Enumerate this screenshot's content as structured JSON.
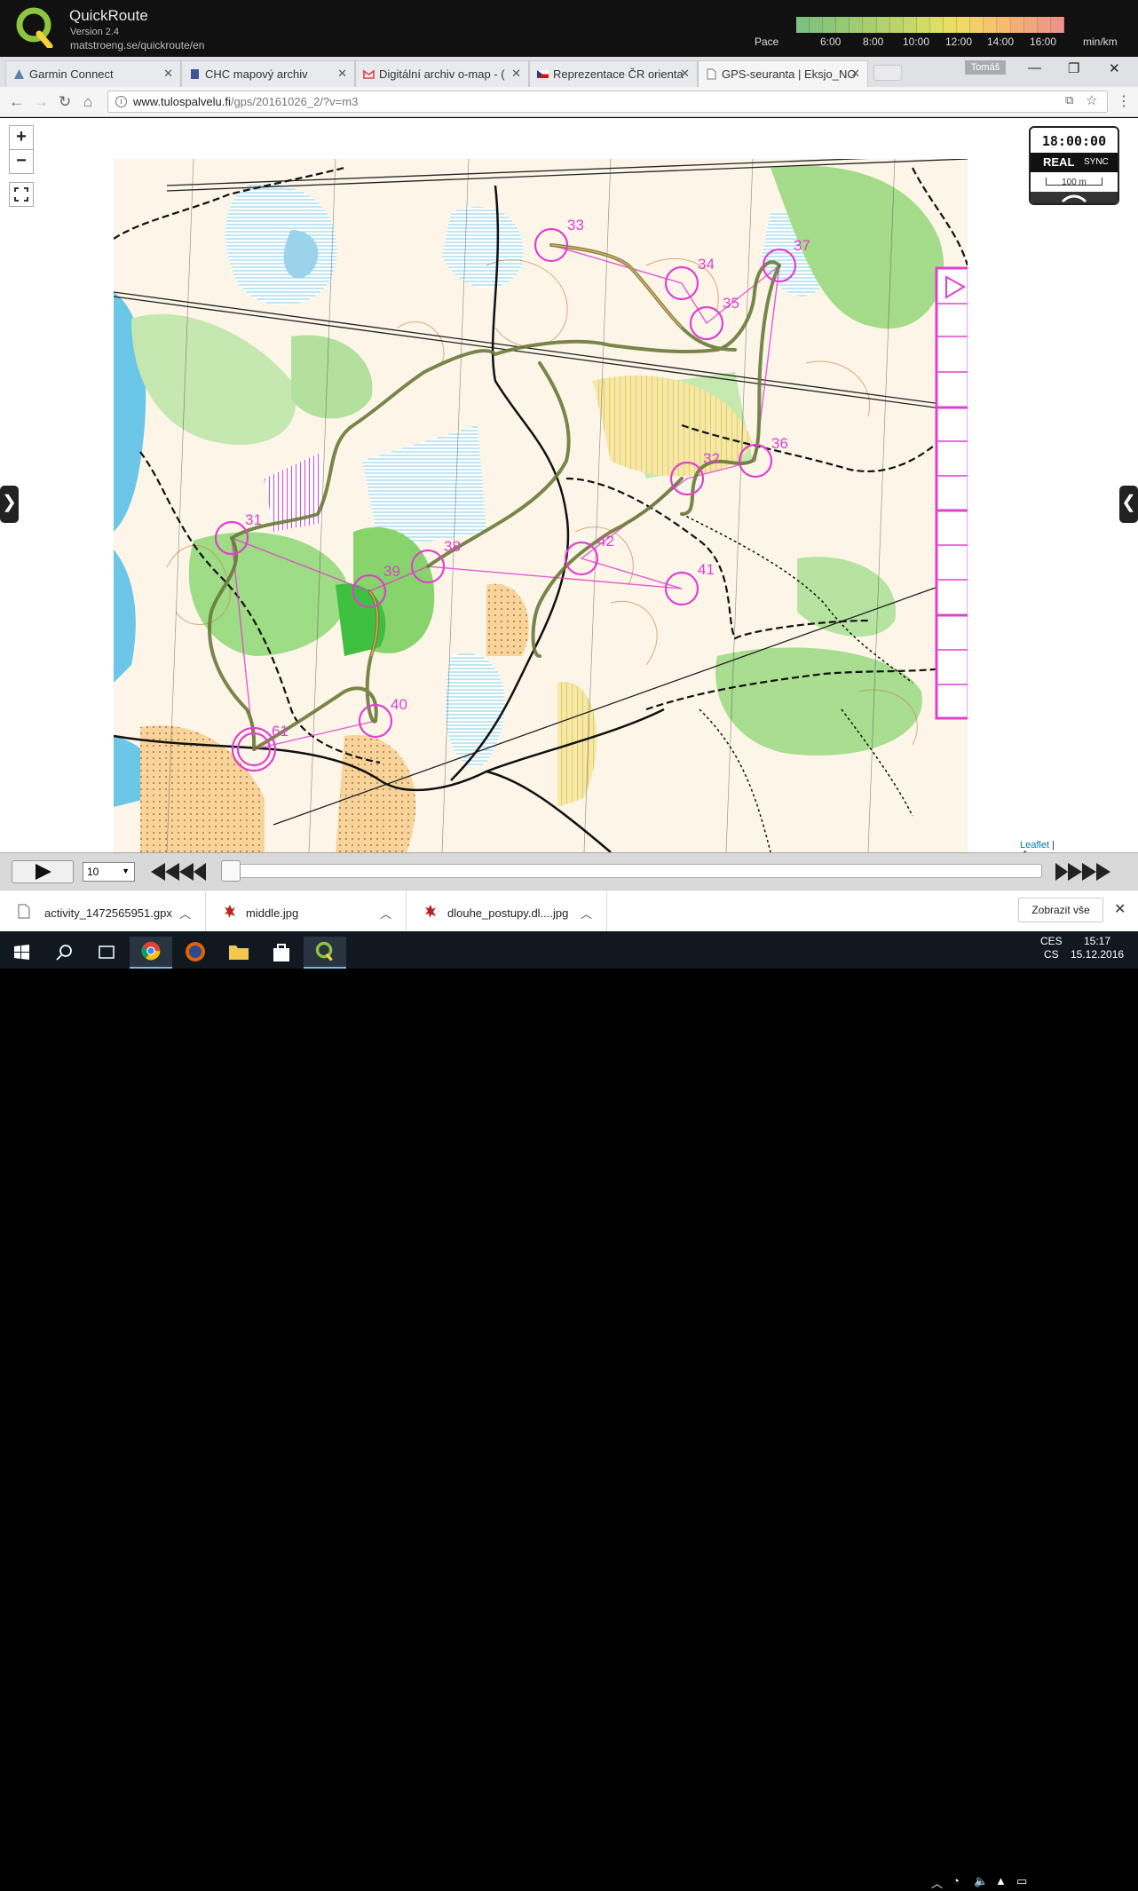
{
  "quickroute": {
    "title": "QuickRoute",
    "version": "Version 2.4",
    "url": "matstroeng.se/quickroute/en",
    "pace_label": "Pace",
    "pace_ticks": [
      "6:00",
      "8:00",
      "10:00",
      "12:00",
      "14:00",
      "16:00"
    ],
    "pace_unit": "min/km",
    "pace_colors": [
      "#7fbf7f",
      "#86c27c",
      "#8ec579",
      "#97c876",
      "#a0cb73",
      "#a9ce70",
      "#b3d16d",
      "#bdd46b",
      "#c8d769",
      "#d3da67",
      "#dedd66",
      "#e8de66",
      "#efd866",
      "#f2cf68",
      "#f3c56c",
      "#f4bb71",
      "#f3b076",
      "#f2a67c",
      "#f09c82",
      "#ee9389"
    ]
  },
  "browser": {
    "tabs": [
      {
        "label": "Garmin Connect",
        "icon": "garmin-triangle-icon"
      },
      {
        "label": "CHC mapový archiv",
        "icon": "document-icon"
      },
      {
        "label": "Digitální archiv o-map - (",
        "icon": "gmail-icon"
      },
      {
        "label": "Reprezentace ČR orienta",
        "icon": "czech-flag-icon"
      },
      {
        "label": "GPS-seuranta | Eksjo_NO",
        "icon": "page-icon"
      }
    ],
    "user": "Tomáš",
    "address": {
      "host": "www.tulospalvelu.fi",
      "path": "/gps/20161026_2/?v=m3"
    }
  },
  "map": {
    "controls": {
      "zoom_in": "+",
      "zoom_out": "−"
    },
    "clock": {
      "time": "18:00:00",
      "mode_real": "REAL",
      "mode_sync": "SYNC",
      "scale": "100 m"
    },
    "controls_points": [
      "33",
      "34",
      "35",
      "36",
      "37",
      "31",
      "32",
      "38",
      "39",
      "40",
      "41",
      "42",
      "61"
    ],
    "attribution": {
      "leaflet": "Leaflet",
      "rest": " | �gpsseuranta.net"
    }
  },
  "playback": {
    "speed": "10"
  },
  "downloads": {
    "items": [
      {
        "name": "activity_1472565951.gpx",
        "icon": "file-icon"
      },
      {
        "name": "middle.jpg",
        "icon": "image-file-icon"
      },
      {
        "name": "dlouhe_postupy.dl....jpg",
        "icon": "image-file-icon"
      }
    ],
    "show_all": "Zobrazit vše"
  },
  "taskbar": {
    "lang_top": "CES",
    "lang_bottom": "CS",
    "time": "15:17",
    "date": "15.12.2016"
  }
}
